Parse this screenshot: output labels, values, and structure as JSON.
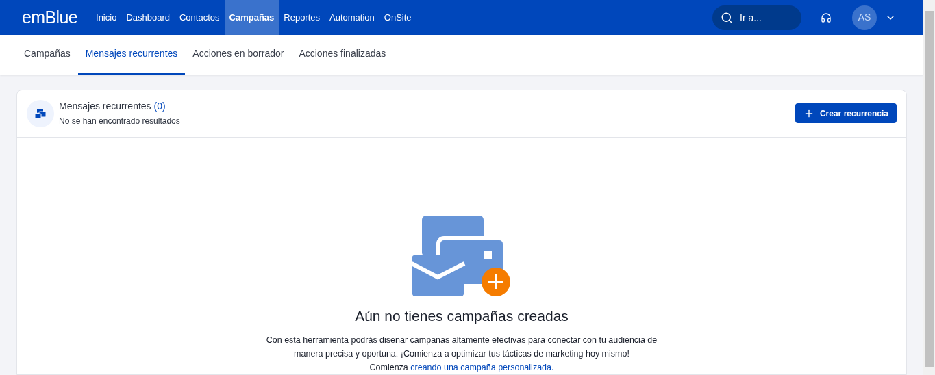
{
  "topbar": {
    "logo": "emBlue",
    "nav": [
      {
        "label": "Inicio",
        "selected": false
      },
      {
        "label": "Dashboard",
        "selected": false
      },
      {
        "label": "Contactos",
        "selected": false
      },
      {
        "label": "Campañas",
        "selected": true
      },
      {
        "label": "Reportes",
        "selected": false
      },
      {
        "label": "Automation",
        "selected": false
      },
      {
        "label": "OnSite",
        "selected": false
      }
    ],
    "search": {
      "placeholder": "Ir a..."
    },
    "avatar": "AS"
  },
  "tabs": [
    {
      "label": "Campañas",
      "selected": false
    },
    {
      "label": "Mensajes recurrentes",
      "selected": true
    },
    {
      "label": "Acciones en borrador",
      "selected": false
    },
    {
      "label": "Acciones finalizadas",
      "selected": false
    }
  ],
  "card": {
    "title": "Mensajes recurrentes",
    "count": "(0)",
    "subtitle": "No se han encontrado resultados",
    "button": "Crear recurrencia"
  },
  "empty_state": {
    "heading": "Aún no tienes campañas creadas",
    "description": "Con esta herramienta podrás diseñar campañas altamente efectivas para conectar con tu audiencia de manera precisa y oportuna. ¡Comienza a optimizar tus tácticas de marketing hoy mismo!",
    "cta_lead": "Comienza",
    "cta_link": "creando una campaña personalizada."
  }
}
